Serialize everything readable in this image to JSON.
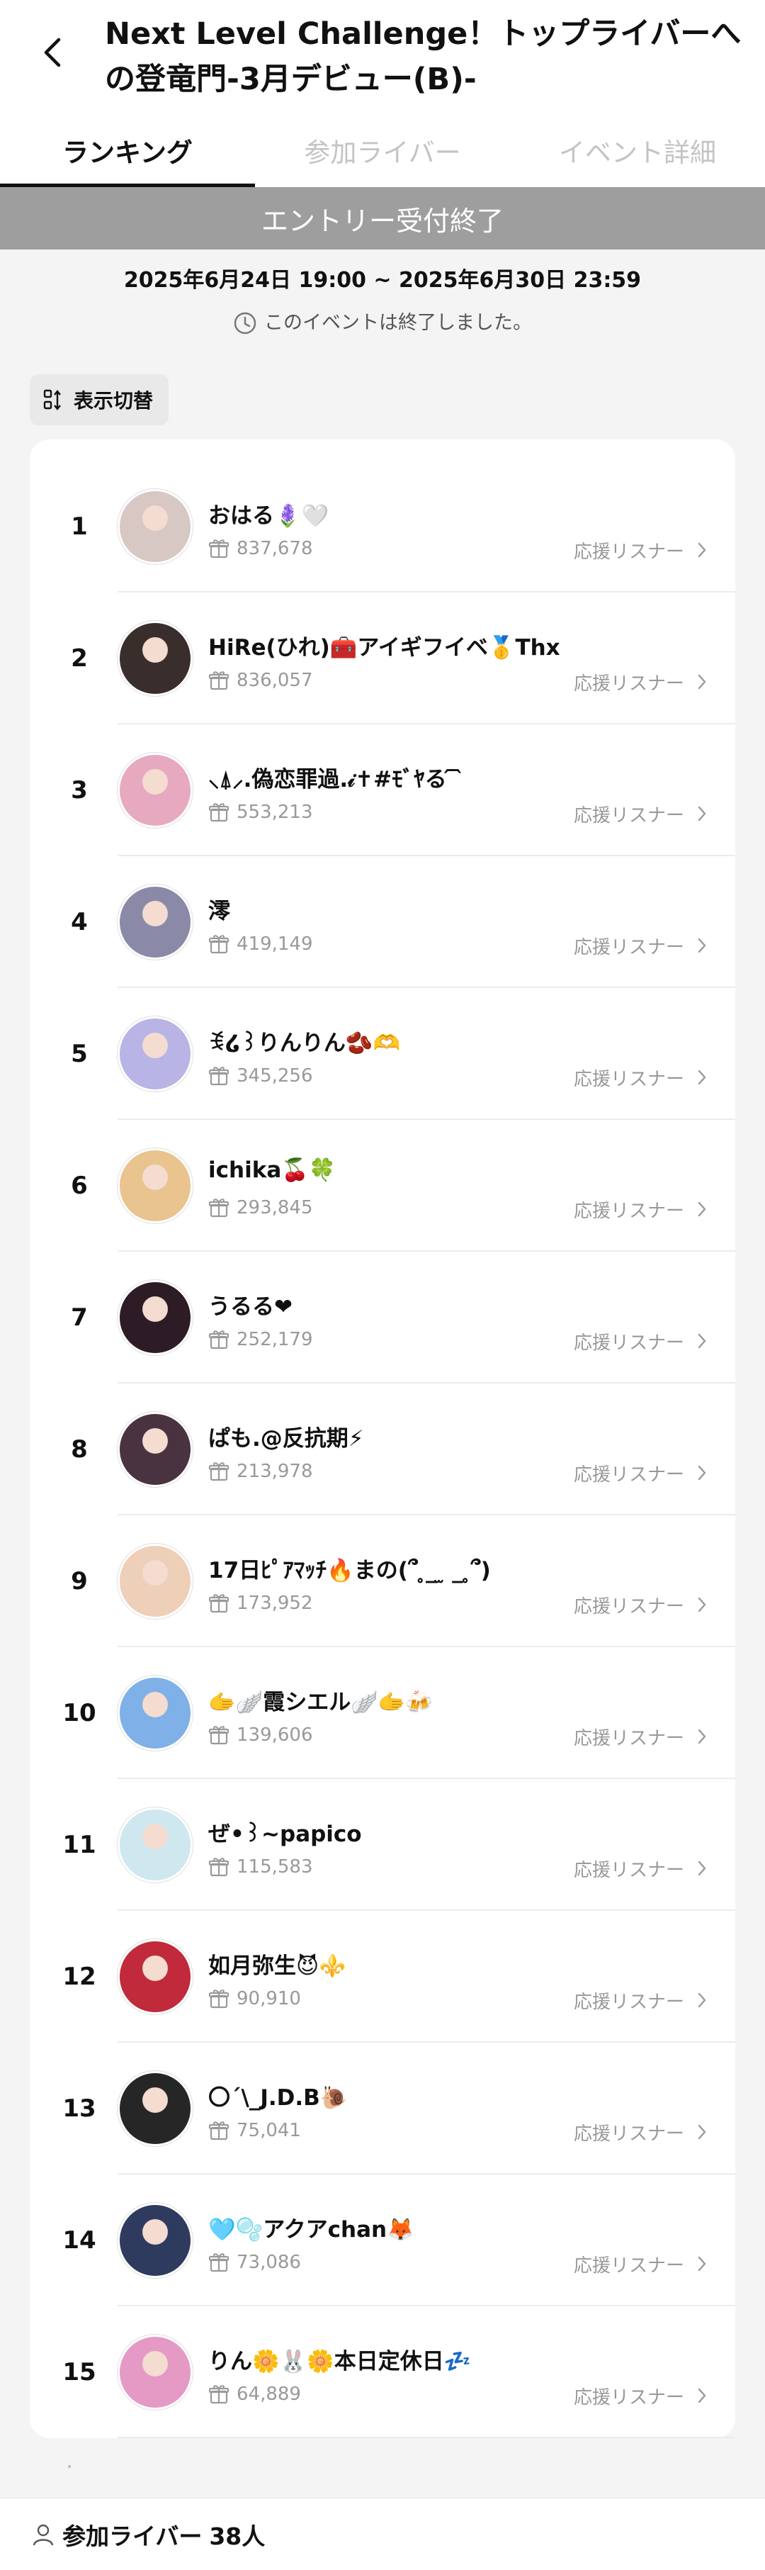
{
  "header": {
    "title": "Next Level Challenge！トップライバーへの登竜門-3月デビュー(B)-"
  },
  "tabs": [
    {
      "label": "ランキング",
      "active": true
    },
    {
      "label": "参加ライバー",
      "active": false
    },
    {
      "label": "イベント詳細",
      "active": false
    }
  ],
  "banner": {
    "text": "エントリー受付終了"
  },
  "event": {
    "date_range": "2025年6月24日 19:00 ~ 2025年6月30日 23:59",
    "status": "このイベントは終了しました。"
  },
  "toggle": {
    "label": "表示切替"
  },
  "listener_label": "応援リスナー",
  "ranking": [
    {
      "rank": "1",
      "name": "おはる🪻🤍",
      "score": "837,678"
    },
    {
      "rank": "2",
      "name": "HiRe(ひれ)🧰アイギフイベ🥇Thx",
      "score": "836,057"
    },
    {
      "rank": "3",
      "name": "⸜⍋⸝.偽恋罪過.𝒾✝︎#ﾓﾞﾔる ᷇ ᷆",
      "score": "553,213"
    },
    {
      "rank": "4",
      "name": "澪",
      "score": "419,149"
    },
    {
      "rank": "5",
      "name": "ꉂ໒꒱りんりん🫘🫶",
      "score": "345,256"
    },
    {
      "rank": "6",
      "name": "ichika🍒🍀",
      "score": "293,845"
    },
    {
      "rank": "7",
      "name": "うるる❤︎",
      "score": "252,179"
    },
    {
      "rank": "8",
      "name": "ぱも.@反抗期⚡︎",
      "score": "213,978"
    },
    {
      "rank": "9",
      "name": "17日ﾋﾟｱﾏｯﾁ🔥まの(՞ ̥_ ̫ _ ̥՞)",
      "score": "173,952"
    },
    {
      "rank": "10",
      "name": "🫱🪽霞シエル🪽🫱🍻",
      "score": "139,606"
    },
    {
      "rank": "11",
      "name": "ぜ•꒱~papico",
      "score": "115,583"
    },
    {
      "rank": "12",
      "name": "如月弥生😈⚜️",
      "score": "90,910"
    },
    {
      "rank": "13",
      "name": "〇´\\_J.D.B🐌",
      "score": "75,041"
    },
    {
      "rank": "14",
      "name": "🩵🫧アクアchan🦊",
      "score": "73,086"
    },
    {
      "rank": "15",
      "name": "りん🌼🐰🌼本日定休日💤",
      "score": "64,889"
    }
  ],
  "avatar_colors": [
    "#d8c8c4",
    "#3a2e2c",
    "#e7a9c0",
    "#8a8aa8",
    "#b9b4e6",
    "#e9c48e",
    "#2d1c26",
    "#4a3340",
    "#eecfb8",
    "#7fb0e8",
    "#cfe7ef",
    "#c02a3a",
    "#262626",
    "#2e3b5e",
    "#e59ac6"
  ],
  "footer": {
    "label": "参加ライバー",
    "count": "38人"
  },
  "colors": {
    "banner": "#9e9e9e",
    "muted": "#999999",
    "text": "#111111"
  },
  "icons": {
    "back": "chevron-left-icon",
    "clock": "clock-icon",
    "swap": "swap-icon",
    "gift": "gift-icon",
    "person": "person-icon"
  }
}
